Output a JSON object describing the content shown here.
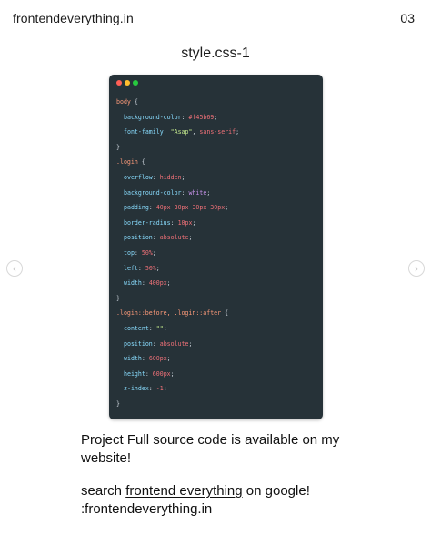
{
  "header": {
    "brand": "frontendeverything.in",
    "page_number": "03"
  },
  "title": "style.css-1",
  "nav": {
    "prev_glyph": "‹",
    "next_glyph": "›"
  },
  "code_window": {
    "dots": [
      "#ff5f56",
      "#ffbd2e",
      "#27c93f"
    ],
    "lines": [
      {
        "indent": 0,
        "tokens": [
          {
            "t": "body ",
            "c": "sel"
          },
          {
            "t": "{",
            "c": "brace"
          }
        ]
      },
      {
        "indent": 1,
        "tokens": [
          {
            "t": "background-color",
            "c": "prop"
          },
          {
            "t": ": ",
            "c": "punct"
          },
          {
            "t": "#f45b69",
            "c": "val"
          },
          {
            "t": ";",
            "c": "punct"
          }
        ]
      },
      {
        "indent": 1,
        "tokens": [
          {
            "t": "font-family",
            "c": "prop"
          },
          {
            "t": ": ",
            "c": "punct"
          },
          {
            "t": "\"Asap\"",
            "c": "str"
          },
          {
            "t": ", ",
            "c": "punct"
          },
          {
            "t": "sans-serif",
            "c": "val"
          },
          {
            "t": ";",
            "c": "punct"
          }
        ]
      },
      {
        "indent": 0,
        "tokens": [
          {
            "t": "}",
            "c": "brace"
          }
        ]
      },
      {
        "indent": 0,
        "tokens": [
          {
            "t": ".login ",
            "c": "sel"
          },
          {
            "t": "{",
            "c": "brace"
          }
        ]
      },
      {
        "indent": 1,
        "tokens": [
          {
            "t": "overflow",
            "c": "prop"
          },
          {
            "t": ": ",
            "c": "punct"
          },
          {
            "t": "hidden",
            "c": "val"
          },
          {
            "t": ";",
            "c": "punct"
          }
        ]
      },
      {
        "indent": 1,
        "tokens": [
          {
            "t": "background-color",
            "c": "prop"
          },
          {
            "t": ": ",
            "c": "punct"
          },
          {
            "t": "white",
            "c": "kw"
          },
          {
            "t": ";",
            "c": "punct"
          }
        ]
      },
      {
        "indent": 1,
        "tokens": [
          {
            "t": "padding",
            "c": "prop"
          },
          {
            "t": ": ",
            "c": "punct"
          },
          {
            "t": "40px 30px 30px 30px",
            "c": "val"
          },
          {
            "t": ";",
            "c": "punct"
          }
        ]
      },
      {
        "indent": 1,
        "tokens": [
          {
            "t": "border-radius",
            "c": "prop"
          },
          {
            "t": ": ",
            "c": "punct"
          },
          {
            "t": "10px",
            "c": "val"
          },
          {
            "t": ";",
            "c": "punct"
          }
        ]
      },
      {
        "indent": 1,
        "tokens": [
          {
            "t": "position",
            "c": "prop"
          },
          {
            "t": ": ",
            "c": "punct"
          },
          {
            "t": "absolute",
            "c": "val"
          },
          {
            "t": ";",
            "c": "punct"
          }
        ]
      },
      {
        "indent": 1,
        "tokens": [
          {
            "t": "top",
            "c": "prop"
          },
          {
            "t": ": ",
            "c": "punct"
          },
          {
            "t": "50%",
            "c": "val"
          },
          {
            "t": ";",
            "c": "punct"
          }
        ]
      },
      {
        "indent": 1,
        "tokens": [
          {
            "t": "left",
            "c": "prop"
          },
          {
            "t": ": ",
            "c": "punct"
          },
          {
            "t": "50%",
            "c": "val"
          },
          {
            "t": ";",
            "c": "punct"
          }
        ]
      },
      {
        "indent": 1,
        "tokens": [
          {
            "t": "width",
            "c": "prop"
          },
          {
            "t": ": ",
            "c": "punct"
          },
          {
            "t": "400px",
            "c": "val"
          },
          {
            "t": ";",
            "c": "punct"
          }
        ]
      },
      {
        "indent": 0,
        "tokens": [
          {
            "t": "}",
            "c": "brace"
          }
        ]
      },
      {
        "indent": 0,
        "tokens": [
          {
            "t": ".login::before, .login::after ",
            "c": "sel"
          },
          {
            "t": "{",
            "c": "brace"
          }
        ]
      },
      {
        "indent": 1,
        "tokens": [
          {
            "t": "content",
            "c": "prop"
          },
          {
            "t": ": ",
            "c": "punct"
          },
          {
            "t": "\"\"",
            "c": "str"
          },
          {
            "t": ";",
            "c": "punct"
          }
        ]
      },
      {
        "indent": 1,
        "tokens": [
          {
            "t": "position",
            "c": "prop"
          },
          {
            "t": ": ",
            "c": "punct"
          },
          {
            "t": "absolute",
            "c": "val"
          },
          {
            "t": ";",
            "c": "punct"
          }
        ]
      },
      {
        "indent": 1,
        "tokens": [
          {
            "t": "width",
            "c": "prop"
          },
          {
            "t": ": ",
            "c": "punct"
          },
          {
            "t": "600px",
            "c": "val"
          },
          {
            "t": ";",
            "c": "punct"
          }
        ]
      },
      {
        "indent": 1,
        "tokens": [
          {
            "t": "height",
            "c": "prop"
          },
          {
            "t": ": ",
            "c": "punct"
          },
          {
            "t": "600px",
            "c": "val"
          },
          {
            "t": ";",
            "c": "punct"
          }
        ]
      },
      {
        "indent": 1,
        "tokens": [
          {
            "t": "z-index",
            "c": "prop"
          },
          {
            "t": ": ",
            "c": "punct"
          },
          {
            "t": "-1",
            "c": "val"
          },
          {
            "t": ";",
            "c": "punct"
          }
        ]
      },
      {
        "indent": 0,
        "tokens": [
          {
            "t": "}",
            "c": "brace"
          }
        ]
      }
    ]
  },
  "footer": {
    "line1": "Project Full source code is available on my website!",
    "search_prefix": "search ",
    "search_link": "frontend everything",
    "search_suffix": " on google!",
    "site": ":frontendeverything.in"
  }
}
